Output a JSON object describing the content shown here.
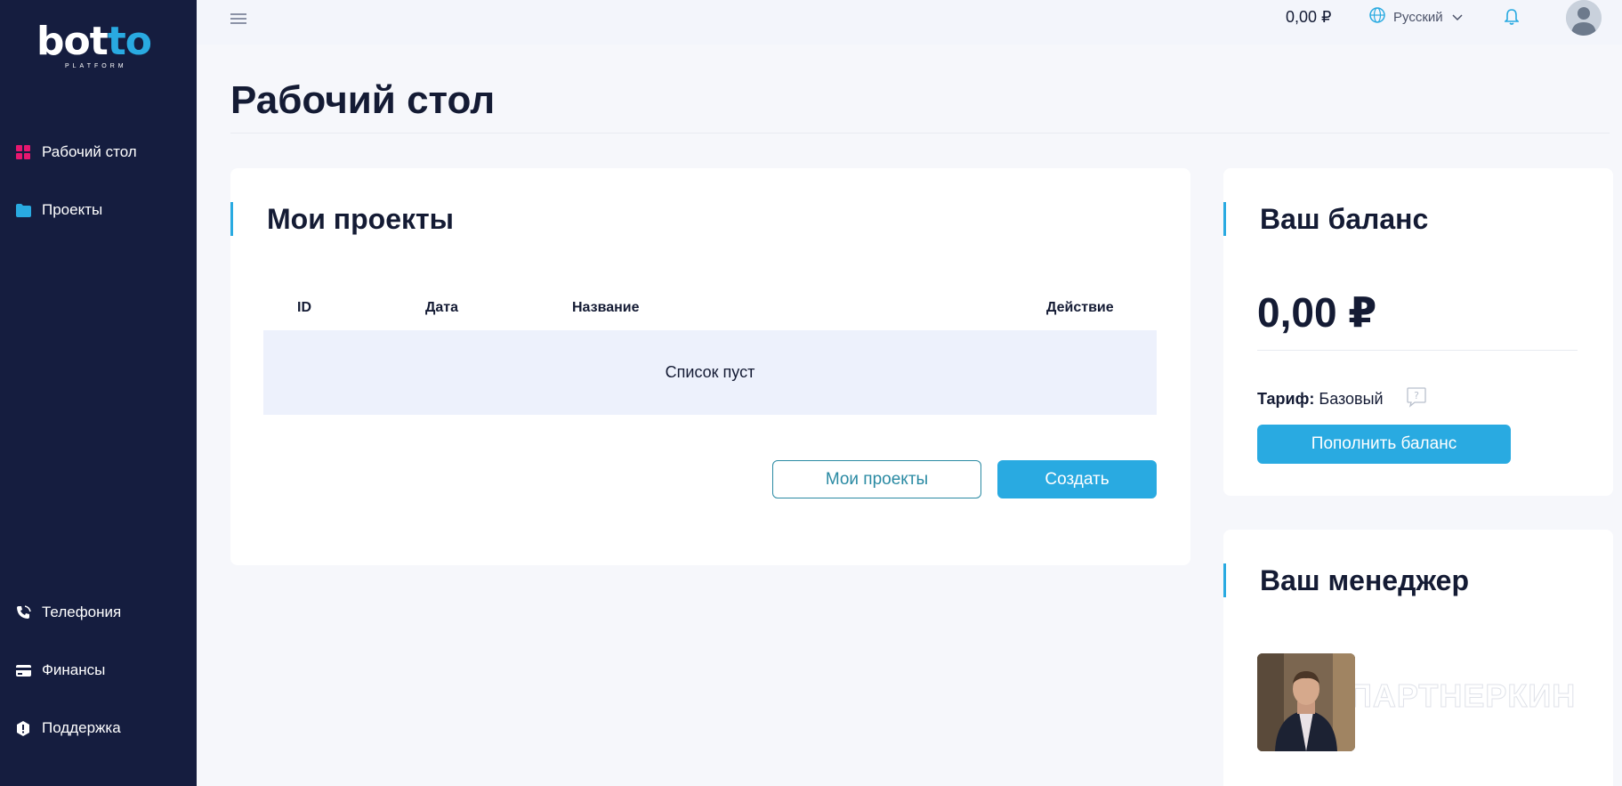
{
  "logo": {
    "text_main": "bot",
    "text_accent": "to",
    "subtitle": "PLATFORM"
  },
  "sidebar": {
    "items": [
      {
        "label": "Рабочий стол",
        "icon": "dashboard-icon"
      },
      {
        "label": "Проекты",
        "icon": "folder-icon"
      },
      {
        "label": "Телефония",
        "icon": "phone-icon"
      },
      {
        "label": "Финансы",
        "icon": "card-icon"
      },
      {
        "label": "Поддержка",
        "icon": "support-icon"
      }
    ]
  },
  "topbar": {
    "balance": "0,00 ₽",
    "language": "Русский"
  },
  "page": {
    "title": "Рабочий стол"
  },
  "projects": {
    "heading": "Мои проекты",
    "columns": [
      "ID",
      "Дата",
      "Название",
      "Действие"
    ],
    "empty_text": "Список пуст",
    "btn_my_projects": "Мои проекты",
    "btn_create": "Создать"
  },
  "balance": {
    "heading": "Ваш баланс",
    "amount": "0,00 ₽",
    "tariff_label": "Тариф:",
    "tariff_value": "Базовый",
    "btn_topup": "Пополнить баланс"
  },
  "manager": {
    "heading": "Ваш менеджер",
    "watermark": "ПАРТНЕРКИН"
  },
  "colors": {
    "sidebar_bg": "#151d3f",
    "accent": "#29aae1",
    "dashboard_icon": "#e6176f",
    "folder_icon": "#29aae1"
  }
}
